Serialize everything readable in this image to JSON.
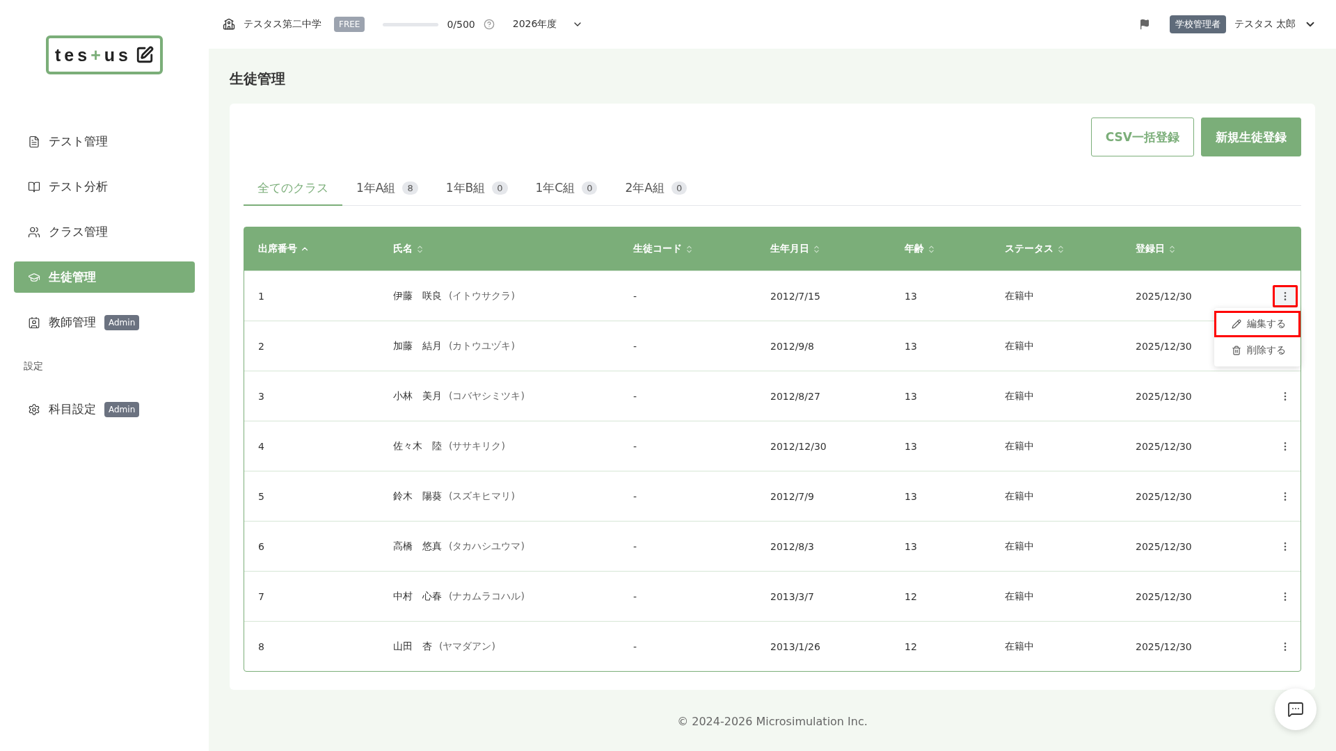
{
  "logo": {
    "text_a": "tes",
    "plus": "+",
    "text_b": "us"
  },
  "sidebar": {
    "items": [
      {
        "label": "テスト管理",
        "selected": false
      },
      {
        "label": "テスト分析",
        "selected": false
      },
      {
        "label": "クラス管理",
        "selected": false
      },
      {
        "label": "生徒管理",
        "selected": true
      },
      {
        "label": "教師管理",
        "selected": false,
        "badge": "Admin"
      }
    ],
    "section_title": "設定",
    "settings_items": [
      {
        "label": "科目設定",
        "selected": false,
        "badge": "Admin"
      }
    ]
  },
  "topbar": {
    "school": "テスタス第二中学",
    "plan": "FREE",
    "usage": {
      "level": 0,
      "reading": "0/500"
    },
    "year": "2026年度",
    "role": "学校管理者",
    "user": "テスタス 太郎"
  },
  "page_title": "生徒管理",
  "actions": [
    {
      "label": "CSV一括登録",
      "kind": "outline"
    },
    {
      "label": "新規生徒登録",
      "kind": "primary"
    }
  ],
  "tabs": [
    {
      "label": "全てのクラス",
      "selected": true
    },
    {
      "label": "1年A組",
      "count": "8",
      "selected": false
    },
    {
      "label": "1年B組",
      "count": "0",
      "selected": false
    },
    {
      "label": "1年C組",
      "count": "0",
      "selected": false
    },
    {
      "label": "2年A組",
      "count": "0",
      "selected": false
    }
  ],
  "table": {
    "columns": [
      {
        "label": "出席番号",
        "sorted": true
      },
      {
        "label": "氏名",
        "sorted": false
      },
      {
        "label": "生徒コード",
        "sorted": false
      },
      {
        "label": "生年月日",
        "sorted": false
      },
      {
        "label": "年齢",
        "sorted": false
      },
      {
        "label": "ステータス",
        "sorted": false
      },
      {
        "label": "登録日",
        "sorted": false
      }
    ],
    "rows": [
      {
        "no": "1",
        "name": "伊藤　咲良",
        "kana": "(イトウサクラ)",
        "code": "-",
        "birth": "2012/7/15",
        "age": "13",
        "status": "在籍中",
        "registered": "2025/12/30",
        "menu_open": true
      },
      {
        "no": "2",
        "name": "加藤　結月",
        "kana": "(カトウユヅキ)",
        "code": "-",
        "birth": "2012/9/8",
        "age": "13",
        "status": "在籍中",
        "registered": "2025/12/30",
        "menu_open": false
      },
      {
        "no": "3",
        "name": "小林　美月",
        "kana": "(コバヤシミツキ)",
        "code": "-",
        "birth": "2012/8/27",
        "age": "13",
        "status": "在籍中",
        "registered": "2025/12/30",
        "menu_open": false
      },
      {
        "no": "4",
        "name": "佐々木　陸",
        "kana": "(ササキリク)",
        "code": "-",
        "birth": "2012/12/30",
        "age": "13",
        "status": "在籍中",
        "registered": "2025/12/30",
        "menu_open": false
      },
      {
        "no": "5",
        "name": "鈴木　陽葵",
        "kana": "(スズキヒマリ)",
        "code": "-",
        "birth": "2012/7/9",
        "age": "13",
        "status": "在籍中",
        "registered": "2025/12/30",
        "menu_open": false
      },
      {
        "no": "6",
        "name": "高橋　悠真",
        "kana": "(タカハシユウマ)",
        "code": "-",
        "birth": "2012/8/3",
        "age": "13",
        "status": "在籍中",
        "registered": "2025/12/30",
        "menu_open": false
      },
      {
        "no": "7",
        "name": "中村　心春",
        "kana": "(ナカムラコハル)",
        "code": "-",
        "birth": "2013/3/7",
        "age": "12",
        "status": "在籍中",
        "registered": "2025/12/30",
        "menu_open": false
      },
      {
        "no": "8",
        "name": "山田　杏",
        "kana": "(ヤマダアン)",
        "code": "-",
        "birth": "2013/1/26",
        "age": "12",
        "status": "在籍中",
        "registered": "2025/12/30",
        "menu_open": false
      }
    ]
  },
  "row_menu": [
    {
      "label": "編集する",
      "highlighted": true
    },
    {
      "label": "削除する",
      "highlighted": false
    }
  ],
  "footer": "© 2024-2026 Microsimulation Inc."
}
